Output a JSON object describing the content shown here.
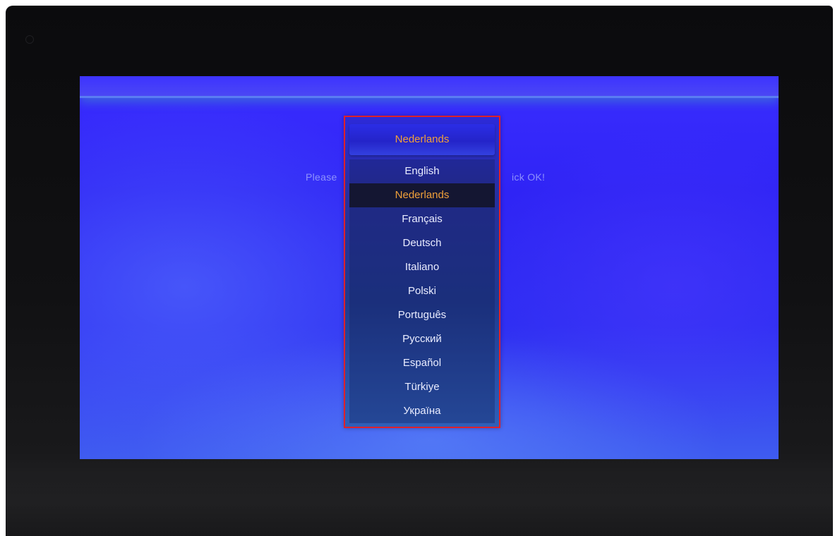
{
  "prompt": {
    "text_left": "Please",
    "text_right": "ick OK!"
  },
  "language_dialog": {
    "title": "Nederlands",
    "selected_index": 1,
    "items": [
      "English",
      "Nederlands",
      "Français",
      "Deutsch",
      "Italiano",
      "Polski",
      "Português",
      "Русский",
      "Español",
      "Türkiye",
      "Україна"
    ]
  },
  "colors": {
    "dialog_border": "#e0202a",
    "selected_text": "#f0a03a",
    "selected_background": "#141632",
    "item_text": "#e9ecff"
  }
}
